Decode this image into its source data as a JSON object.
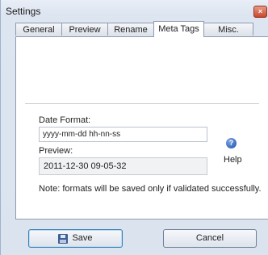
{
  "window": {
    "title": "Settings",
    "close_symbol": "×"
  },
  "tabs": [
    {
      "label": "General"
    },
    {
      "label": "Preview"
    },
    {
      "label": "Rename"
    },
    {
      "label": "Meta Tags",
      "active": true
    },
    {
      "label": "Misc."
    }
  ],
  "meta_tags": {
    "date_format_label": "Date Format:",
    "date_format_value": "yyyy-mm-dd hh-nn-ss",
    "preview_label": "Preview:",
    "preview_value": "2011-12-30 09-05-32",
    "help_label": "Help",
    "note": "Note: formats will be saved only if validated successfully."
  },
  "buttons": {
    "save_label": "Save",
    "cancel_label": "Cancel"
  },
  "icons": {
    "help": "help-icon",
    "save": "floppy-disk-icon",
    "close": "close-icon"
  }
}
